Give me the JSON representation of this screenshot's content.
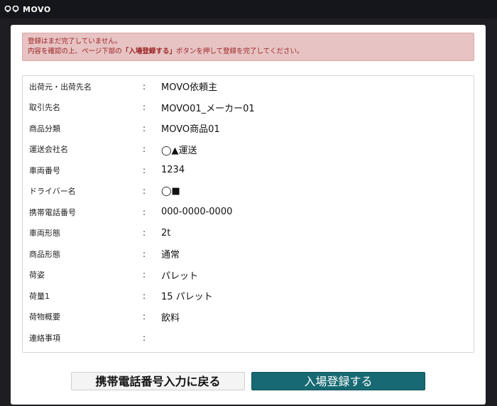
{
  "app": {
    "logo_text": "MOVO",
    "logo_icon": "map-pin-icon"
  },
  "alert": {
    "line1": "登録はまだ完了していません。",
    "line2_prefix": "内容を確認の上、ページ下部の",
    "line2_strong": "「入場登録する」",
    "line2_suffix": "ボタンを押して登録を完了してください。"
  },
  "details": {
    "rows": [
      {
        "label": "出荷元・出荷先名",
        "colon": ":",
        "value": "MOVO依頼主"
      },
      {
        "label": "取引先名",
        "colon": ":",
        "value": "MOVO01_メーカー01"
      },
      {
        "label": "商品分類",
        "colon": ":",
        "value": "MOVO商品01"
      },
      {
        "label": "運送会社名",
        "colon": ":",
        "value": "◯▲運送"
      },
      {
        "label": "車両番号",
        "colon": ":",
        "value": "1234"
      },
      {
        "label": "ドライバー名",
        "colon": ":",
        "value": "◯■"
      },
      {
        "label": "携帯電話番号",
        "colon": ":",
        "value": "000-0000-0000"
      },
      {
        "label": "車両形態",
        "colon": ":",
        "value": "2t"
      },
      {
        "label": "商品形態",
        "colon": ":",
        "value": "通常"
      },
      {
        "label": "荷姿",
        "colon": ":",
        "value": "パレット"
      },
      {
        "label": "荷量1",
        "colon": ":",
        "value": "15 パレット"
      },
      {
        "label": "荷物概要",
        "colon": ":",
        "value": "飲料"
      },
      {
        "label": "連絡事項",
        "colon": ":",
        "value": ""
      }
    ]
  },
  "actions": {
    "back_label": "携帯電話番号入力に戻る",
    "submit_label": "入場登録する"
  },
  "colors": {
    "topbar": "#15161c",
    "alert_bg": "#e7c3c3",
    "alert_text": "#9b2222",
    "submit_bg": "#176a73"
  }
}
